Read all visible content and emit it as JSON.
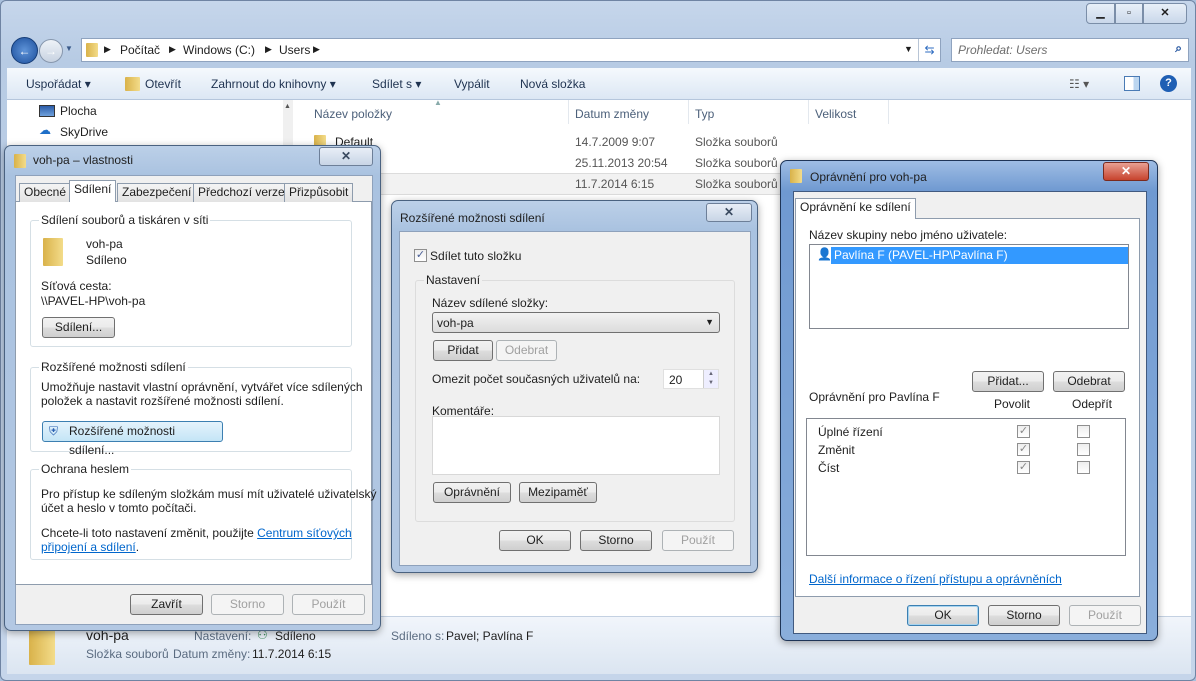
{
  "explorer": {
    "breadcrumb": [
      "Počítač",
      "Windows (C:)",
      "Users"
    ],
    "search_placeholder": "Prohledat: Users",
    "toolbar": {
      "organize": "Uspořádat ▾",
      "open": "Otevřít",
      "include_library": "Zahrnout do knihovny ▾",
      "share_with": "Sdílet s ▾",
      "burn": "Vypálit",
      "new_folder": "Nová složka"
    },
    "nav": [
      "Plocha",
      "SkyDrive"
    ],
    "columns": [
      "Název položky",
      "Datum změny",
      "Typ",
      "Velikost"
    ],
    "rows": [
      {
        "name": "Default",
        "date": "14.7.2009 9:07",
        "type": "Složka souborů"
      },
      {
        "name": "",
        "date": "25.11.2013 20:54",
        "type": "Složka souborů"
      },
      {
        "name": "",
        "date": "11.7.2014 6:15",
        "type": "Složka souborů"
      }
    ],
    "details": {
      "name": "voh-pa",
      "state_label": "Nastavení:",
      "state": "Sdíleno",
      "shared_with_label": "Sdíleno s:",
      "shared_with": "Pavel; Pavlína F",
      "type": "Složka souborů",
      "date_label": "Datum změny:",
      "date": "11.7.2014 6:15"
    }
  },
  "props": {
    "title": "voh-pa – vlastnosti",
    "tabs": [
      "Obecné",
      "Sdílení",
      "Zabezpečení",
      "Předchozí verze",
      "Přizpůsobit"
    ],
    "g1_legend": "Sdílení souborů a tiskáren v síti",
    "name": "voh-pa",
    "status": "Sdíleno",
    "path_label": "Síťová cesta:",
    "path": "\\\\PAVEL-HP\\voh-pa",
    "share_btn": "Sdílení...",
    "g2_legend": "Rozšířené možnosti sdílení",
    "g2_text1": "Umožňuje nastavit vlastní oprávnění, vytvářet více sdílených",
    "g2_text2": "položek a nastavit rozšířené možnosti sdílení.",
    "adv_btn": "Rozšířené možnosti sdílení...",
    "g3_legend": "Ochrana heslem",
    "g3_text1": "Pro přístup ke sdíleným složkám musí mít uživatelé uživatelský",
    "g3_text2": "účet a heslo v tomto počítači.",
    "g3_text3": "Chcete-li toto nastavení změnit, použijte ",
    "g3_link1": "Centrum síťových",
    "g3_link2": "připojení a sdílení",
    "close": "Zavřít",
    "cancel": "Storno",
    "apply": "Použít"
  },
  "adv": {
    "title": "Rozšířené možnosti sdílení",
    "share_check": "Sdílet tuto složku",
    "settings": "Nastavení",
    "share_name_label": "Název sdílené složky:",
    "share_name": "voh-pa",
    "add": "Přidat",
    "remove": "Odebrat",
    "limit_label": "Omezit počet současných uživatelů na:",
    "limit": "20",
    "comments": "Komentáře:",
    "permissions": "Oprávnění",
    "caching": "Mezipaměť",
    "ok": "OK",
    "cancel": "Storno",
    "apply": "Použít"
  },
  "perm": {
    "title": "Oprávnění pro voh-pa",
    "tab": "Oprávnění ke sdílení",
    "group_label": "Název skupiny nebo jméno uživatele:",
    "users": [
      "Pavlína F (PAVEL-HP\\Pavlína F)"
    ],
    "add": "Přidat...",
    "remove": "Odebrat",
    "perm_for": "Oprávnění pro Pavlína F",
    "allow": "Povolit",
    "deny": "Odepřít",
    "items": [
      {
        "name": "Úplné řízení",
        "allow": true,
        "deny": false
      },
      {
        "name": "Změnit",
        "allow": true,
        "deny": false
      },
      {
        "name": "Číst",
        "allow": true,
        "deny": false
      }
    ],
    "link": "Další informace o řízení přístupu a oprávněních",
    "ok": "OK",
    "cancel": "Storno",
    "apply": "Použít"
  }
}
